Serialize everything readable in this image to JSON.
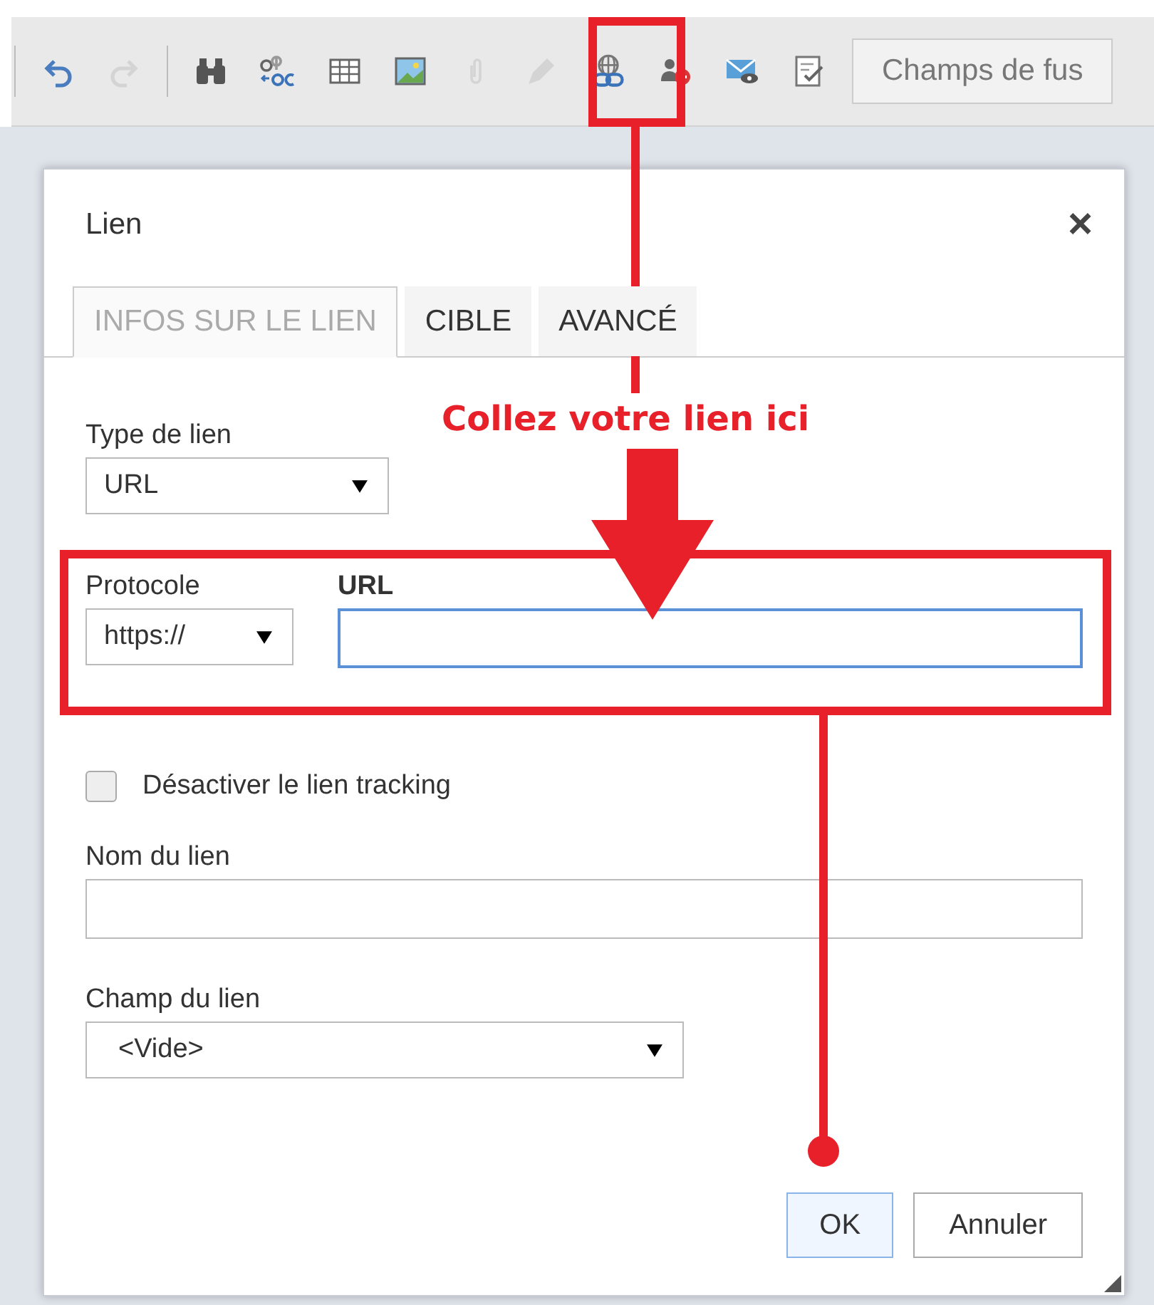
{
  "toolbar": {
    "buttons": [
      {
        "kind": "undo",
        "disabled": false
      },
      {
        "kind": "redo",
        "disabled": true
      },
      {
        "kind": "separator"
      },
      {
        "kind": "find",
        "disabled": false
      },
      {
        "kind": "replace",
        "disabled": false
      },
      {
        "kind": "table",
        "disabled": false
      },
      {
        "kind": "image",
        "disabled": false
      },
      {
        "kind": "attach",
        "disabled": true
      },
      {
        "kind": "pen",
        "disabled": true
      },
      {
        "kind": "link",
        "disabled": false
      },
      {
        "kind": "unsubscribe",
        "disabled": false
      },
      {
        "kind": "preview",
        "disabled": false
      },
      {
        "kind": "form",
        "disabled": false
      }
    ],
    "merge_fields": {
      "label": "Champs de fus"
    }
  },
  "dialog": {
    "title": "Lien",
    "close": "×",
    "tabs": [
      {
        "label": "INFOS SUR LE LIEN",
        "selected": true
      },
      {
        "label": "CIBLE",
        "selected": false
      },
      {
        "label": "AVANCÉ",
        "selected": false
      }
    ],
    "link_type": {
      "label": "Type de lien",
      "value": "URL"
    },
    "protocol": {
      "label": "Protocole",
      "value": "https://"
    },
    "url": {
      "label": "URL",
      "focused": true
    },
    "disable_tracking": {
      "label": "Désactiver le lien tracking",
      "checked": false
    },
    "link_name": {
      "label": "Nom du lien"
    },
    "link_field": {
      "label": "Champ du lien",
      "value": "<Vide>"
    },
    "buttons": [
      {
        "label": "OK",
        "primary": true
      },
      {
        "label": "Annuler",
        "primary": false
      }
    ]
  },
  "annotation": {
    "text": "Collez votre lien ici"
  }
}
